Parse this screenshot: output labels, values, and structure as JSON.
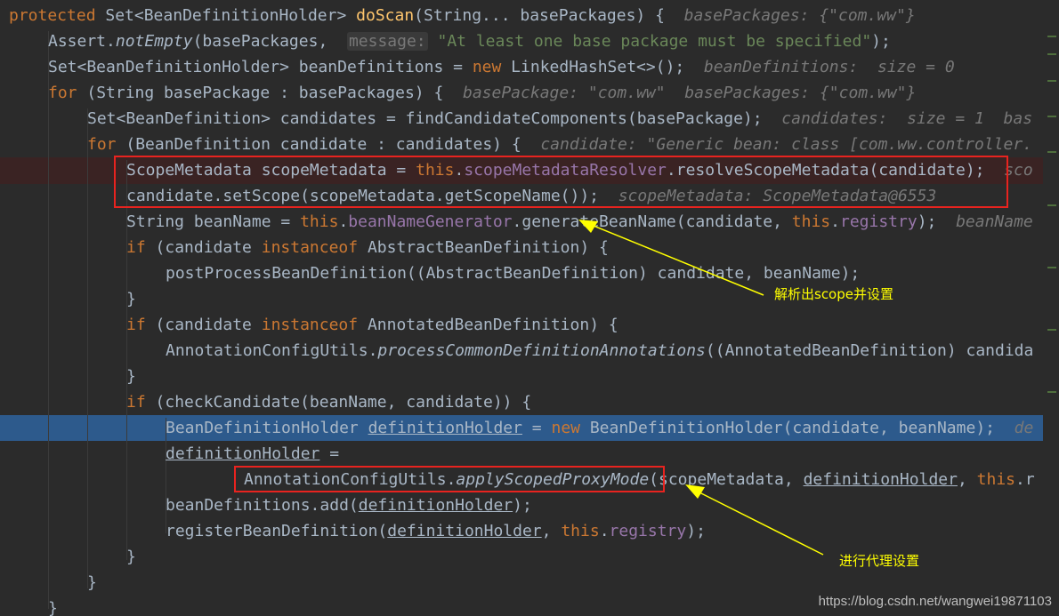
{
  "code": {
    "l1": {
      "kw": "protected ",
      "t1": "Set<BeanDefinitionHolder> ",
      "fn": "doScan",
      "t2": "(String... basePackages) {  ",
      "hint": "basePackages: {\"com.ww\"}"
    },
    "l2": {
      "t1": "Assert.",
      "it": "notEmpty",
      "t2": "(basePackages,  ",
      "param": "message:",
      "st": " \"At least one base package must be specified\"",
      "t3": ");"
    },
    "l3": {
      "t1": "Set<BeanDefinitionHolder> beanDefinitions = ",
      "kw": "new",
      "t2": " LinkedHashSet<>();  ",
      "hint": "beanDefinitions:  size = 0"
    },
    "l4": {
      "kw": "for",
      "t1": " (String basePackage : basePackages) {  ",
      "hint": "basePackage: \"com.ww\"  basePackages: {\"com.ww\"}"
    },
    "l5": {
      "t1": "Set<BeanDefinition> candidates = findCandidateComponents(basePackage);  ",
      "hint": "candidates:  size = 1  bas"
    },
    "l6": {
      "kw": "for",
      "t1": " (BeanDefinition candidate : candidates) {  ",
      "hint": "candidate: \"Generic bean: class [com.ww.controller."
    },
    "l7": {
      "t1": "ScopeMetadata scopeMetadata = ",
      "kw": "this",
      "t2": ".",
      "fld": "scopeMetadataResolver",
      "t3": ".resolveScopeMetadata(candidate);  ",
      "hint": "sco"
    },
    "l8": {
      "t1": "candidate.setScope(scopeMetadata.getScopeName());  ",
      "hint": "scopeMetadata: ScopeMetadata@6553"
    },
    "l9": {
      "t1": "String beanName = ",
      "kw": "this",
      "t2": ".",
      "fld": "beanNameGenerator",
      "t3": ".generateBeanName(candidate, ",
      "kw2": "this",
      "t4": ".",
      "fld2": "registry",
      "t5": ");  ",
      "hint": "beanName"
    },
    "l10": {
      "kw": "if",
      "t1": " (candidate ",
      "kw2": "instanceof",
      "t2": " AbstractBeanDefinition) {"
    },
    "l11": {
      "t1": "postProcessBeanDefinition((AbstractBeanDefinition) candidate, beanName);"
    },
    "l12": {
      "t1": "}"
    },
    "l13": {
      "kw": "if",
      "t1": " (candidate ",
      "kw2": "instanceof",
      "t2": " AnnotatedBeanDefinition) {"
    },
    "l14": {
      "t1": "AnnotationConfigUtils.",
      "it": "processCommonDefinitionAnnotations",
      "t2": "((AnnotatedBeanDefinition) candida"
    },
    "l15": {
      "t1": "}"
    },
    "l16": {
      "kw": "if",
      "t1": " (checkCandidate(beanName, candidate)) {"
    },
    "l17": {
      "t1": "BeanDefinitionHolder ",
      "ul": "definitionHolder",
      "t2": " = ",
      "kw": "new",
      "t3": " BeanDefinitionHolder(candidate, beanName);  ",
      "hint": "de"
    },
    "l18": {
      "ul": "definitionHolder",
      "t1": " ="
    },
    "l19": {
      "t1": "AnnotationConfigUtils.",
      "it": "applyScopedProxyMode",
      "t2": "(scopeMetadata, ",
      "ul": "definitionHolder",
      "t3": ", ",
      "kw": "this",
      "t4": ".r"
    },
    "l20": {
      "t1": "beanDefinitions.add(",
      "ul": "definitionHolder",
      "t2": ");"
    },
    "l21": {
      "t1": "registerBeanDefinition(",
      "ul": "definitionHolder",
      "t2": ", ",
      "kw": "this",
      "t3": ".",
      "fld": "registry",
      "t4": ");"
    },
    "l22": {
      "t1": "}"
    },
    "l23": {
      "t1": "}"
    },
    "l24": {
      "t1": "}"
    }
  },
  "annotations": {
    "scope_note": "解析出scope并设置",
    "proxy_note": "进行代理设置"
  },
  "watermark": "https://blog.csdn.net/wangwei19871103",
  "colors": {
    "background": "#2b2b2b",
    "keyword": "#cc7832",
    "method": "#ffc66d",
    "string": "#6a8759",
    "field": "#9876aa",
    "highlight_box": "#e8231f",
    "annotation": "#ffff00",
    "execution_line": "#2d5a8c"
  }
}
